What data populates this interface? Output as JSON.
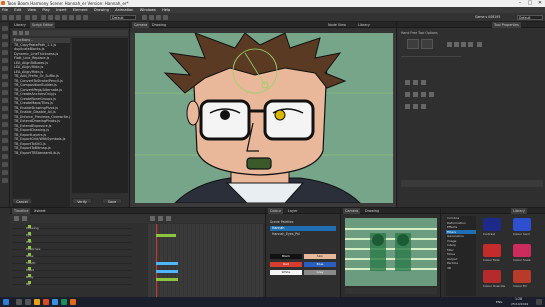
{
  "window": {
    "title": "Toon Boom Harmony Scene: Hannah_er Version: Hannah_er*",
    "minimize": "–",
    "maximize": "□",
    "close": "✕"
  },
  "menu": [
    "File",
    "Edit",
    "View",
    "Play",
    "Insert",
    "Element",
    "Drawing",
    "Animation",
    "Windows",
    "Help"
  ],
  "toolbar": {
    "mode_select": "Default",
    "workspace_select": "Default",
    "workspace_label": "Game s 008195"
  },
  "script_panel": {
    "tabs": [
      "Library",
      "Script Editor"
    ],
    "items": [
      "Functions –",
      "TB_CopyPastePath_1.1.js",
      "duplicateBlocks.js",
      "Dynamic_LineThickness.js",
      "Flatt_Line_Replace.js",
      "LEA_AlignToBoxes.js",
      "LEA_Align/Hide.js",
      "LEA_Align/Hide.js",
      "TB_Add_Prefix_Or_Suffix.js",
      "TB_ConvertToStroke/Pencil.js",
      "TB_CompositionBuilder.js",
      "TB_ConvertPegs/Alternate.js",
      "TB_CreateAnchorsOnly.js",
      "TB_CreateBoneGroups.js",
      "TB_CreateMaps/Tiles.js",
      "TB_EnableDrawingPivot.js",
      "TB_Enable_Disable_All.js",
      "TB_Enforce_Previews_Overwrite.js",
      "TB_ExtendDrawingPivots.js",
      "TB_ExtendExposure.js",
      "TB_ExportDrawing.js",
      "TB_ExportLayers.js",
      "TB_ExportGrid/WithSymbols.js",
      "TB_ExportToSVG.js",
      "TB_ExportToBitmap.js",
      "TB_ExportTBStandardLib.js"
    ],
    "buttons": [
      "Cancel",
      "Verify",
      "Save"
    ]
  },
  "camera_view": {
    "tabs": [
      "Camera",
      "Drawing"
    ],
    "side_tabs": [
      "Node View",
      "Library"
    ]
  },
  "tool_properties": {
    "title": "Tool Properties",
    "section": "Hand Free Tool Options",
    "right_tab": "Tool Properties"
  },
  "timeline": {
    "tabs": [
      "Timeline",
      "Xsheet"
    ],
    "layers": [
      "Drawing",
      "Eye",
      "Hair",
      "Eyebrows",
      "Nose",
      "Mouth",
      "Head",
      "Body",
      "Bg"
    ]
  },
  "colour_panel": {
    "tabs": [
      "Colour",
      "Layer"
    ],
    "palette_header": "Scene Palettes",
    "palettes": [
      "Hannah",
      "Hannah_Eyes_Pal"
    ],
    "swatches": [
      {
        "label": "Black",
        "color": "#111111",
        "text": "#ffffff"
      },
      {
        "label": "Skin",
        "color": "#e8b89a",
        "text": "#222222"
      },
      {
        "label": "Red",
        "color": "#d63d2e",
        "text": "#ffffff"
      },
      {
        "label": "Blue",
        "color": "#2a5fbf",
        "text": "#ffffff"
      },
      {
        "label": "White",
        "color": "#f5f5f5",
        "text": "#222222"
      },
      {
        "label": "Grey",
        "color": "#8a8a8a",
        "text": "#ffffff"
      }
    ]
  },
  "preview": {
    "tabs": [
      "Camera",
      "Drawing"
    ]
  },
  "library": {
    "tab": "Library",
    "folders": [
      "Combos",
      "Deformation",
      "Effects",
      "Filters",
      "Generators",
      "Image",
      "Interp",
      "Misc",
      "Move",
      "Output",
      "Particle",
      "3D"
    ],
    "selected_folder": "Filters",
    "templates": [
      {
        "label": "Contrast",
        "color": "#1e2a8a"
      },
      {
        "label": "Colour Card",
        "color": "#2e4fd0"
      },
      {
        "label": "Colour Fade",
        "color": "#c42b2b"
      },
      {
        "label": "Colour Scale",
        "color": "#cc2b5e"
      },
      {
        "label": "Colour Override",
        "color": "#b52b2b"
      },
      {
        "label": "Colour Fill",
        "color": "#b83a2a"
      }
    ]
  },
  "taskbar": {
    "time": "1:28",
    "date": "25/10/2019",
    "lang": "ENG"
  },
  "colors": {
    "canvas_bg": "#77a58a",
    "hair": "#5a3a22",
    "skin": "#e9b89a",
    "accent": "#1f6fb2"
  }
}
